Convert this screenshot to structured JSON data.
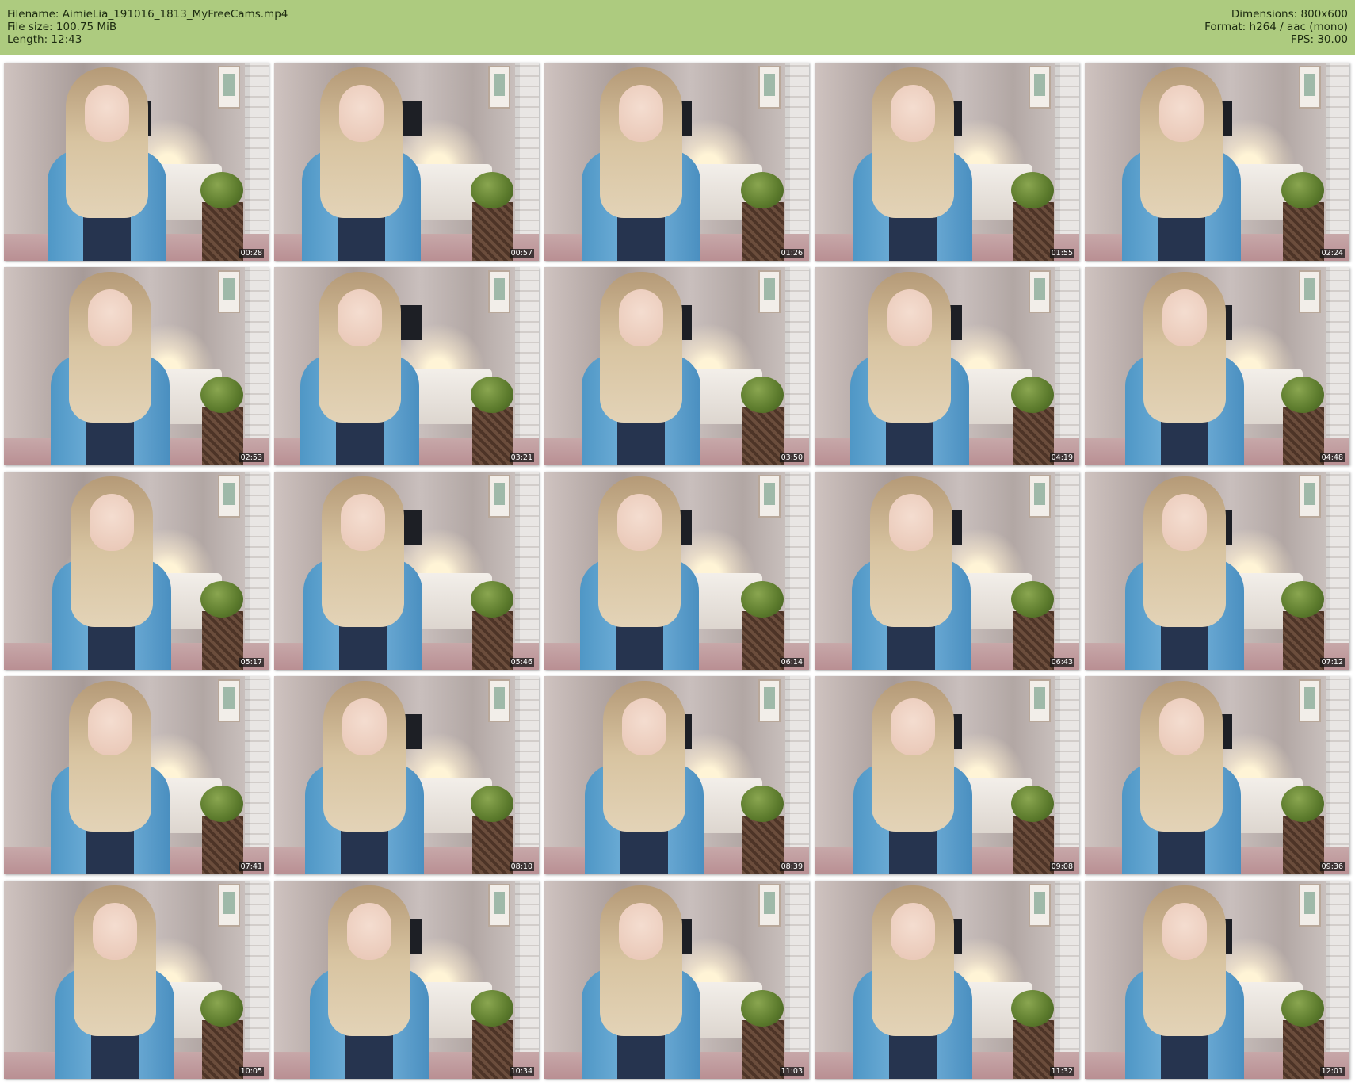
{
  "header": {
    "filename_line": "Filename: AimieLia_191016_1813_MyFreeCams.mp4",
    "filesize_line": "File size: 100.75 MiB",
    "length_line": "Length: 12:43",
    "dimensions_line": "Dimensions: 800x600",
    "format_line": "Format: h264 / aac (mono)",
    "fps_line": "FPS: 30.00",
    "background_color": "#adcb7f"
  },
  "thumbnails": [
    {
      "timestamp": "00:28"
    },
    {
      "timestamp": "00:57"
    },
    {
      "timestamp": "01:26"
    },
    {
      "timestamp": "01:55"
    },
    {
      "timestamp": "02:24"
    },
    {
      "timestamp": "02:53"
    },
    {
      "timestamp": "03:21"
    },
    {
      "timestamp": "03:50"
    },
    {
      "timestamp": "04:19"
    },
    {
      "timestamp": "04:48"
    },
    {
      "timestamp": "05:17"
    },
    {
      "timestamp": "05:46"
    },
    {
      "timestamp": "06:14"
    },
    {
      "timestamp": "06:43"
    },
    {
      "timestamp": "07:12"
    },
    {
      "timestamp": "07:41"
    },
    {
      "timestamp": "08:10"
    },
    {
      "timestamp": "08:39"
    },
    {
      "timestamp": "09:08"
    },
    {
      "timestamp": "09:36"
    },
    {
      "timestamp": "10:05"
    },
    {
      "timestamp": "10:34"
    },
    {
      "timestamp": "11:03"
    },
    {
      "timestamp": "11:32"
    },
    {
      "timestamp": "12:01"
    }
  ]
}
